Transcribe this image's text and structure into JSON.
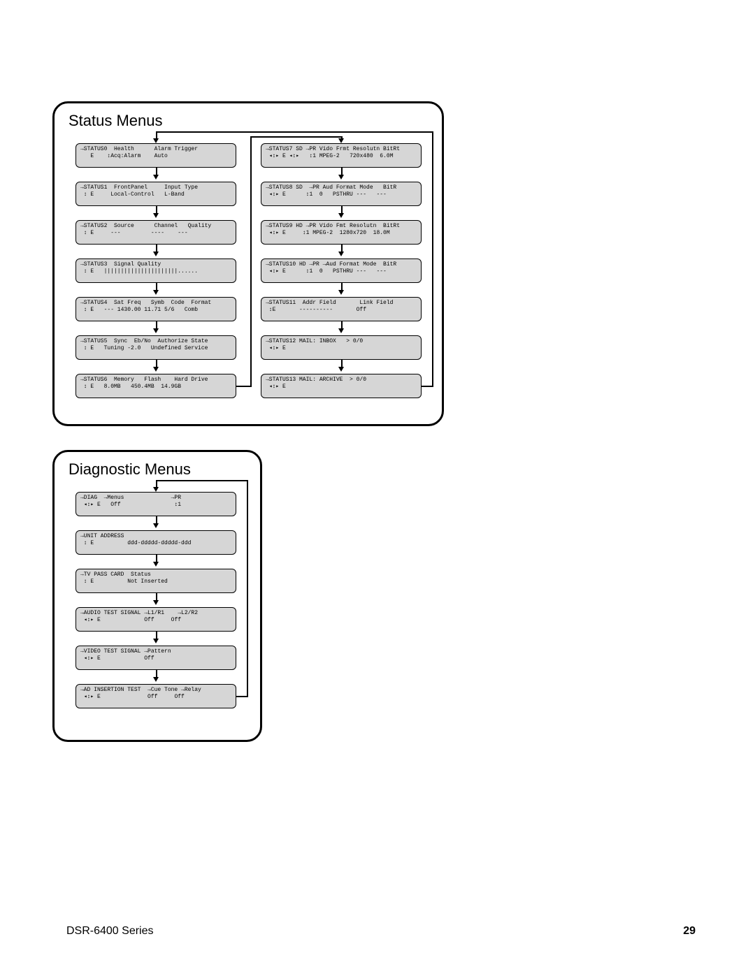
{
  "footer": {
    "model": "DSR-6400 Series",
    "page": "29"
  },
  "status": {
    "title": "Status Menus",
    "left": [
      {
        "l1": "→STATUS0  Health      Alarm Trigger",
        "l2": "   E    ↕Acq:Alarm    Auto"
      },
      {
        "l1": "→STATUS1  FrontPanel     Input Type",
        "l2": " ↕ E     Local-Control   L-Band"
      },
      {
        "l1": "→STATUS2  Source      Channel   Quality",
        "l2": " ↕ E     ---         ----    ---"
      },
      {
        "l1": "→STATUS3  Signal Quality",
        "l2": " ↕ E   ||||||||||||||||||||||......"
      },
      {
        "l1": "→STATUS4  Sat Freq   Symb  Code  Format",
        "l2": " ↕ E   --- 1430.00 11.71 5/6   Comb"
      },
      {
        "l1": "→STATUS5  Sync  Eb/No  Authorize State",
        "l2": " ↕ E   Tuning -2.0   Undefined Service"
      },
      {
        "l1": "→STATUS6  Memory   Flash    Hard Drive",
        "l2": " ↕ E   8.0MB   450.4MB  14.9GB"
      }
    ],
    "right": [
      {
        "l1": "→STATUS7 SD →PR Vido Frmt Resolutn BitRt",
        "l2": " ◂↕▸ E ◂↕▸   ↕1 MPEG-2   720x480  6.0M"
      },
      {
        "l1": "→STATUS8 SD  →PR Aud Format Mode   BitR",
        "l2": " ◂↕▸ E      ↕1  0   PSTHRU ---   ---"
      },
      {
        "l1": "→STATUS9 HD →PR Vido Fmt Resolutn  BitRt",
        "l2": " ◂↕▸ E     ↕1 MPEG-2  1280x720  18.0M"
      },
      {
        "l1": "→STATUS10 HD →PR →Aud Format Mode  BitR",
        "l2": " ◂↕▸ E      ↕1  0   PSTHRU ---   ---"
      },
      {
        "l1": "→STATUS11  Addr Field       Link Field",
        "l2": " ↕E       ----------       Off"
      },
      {
        "l1": "→STATUS12 MAIL: INBOX   > 0/0",
        "l2": " ◂↕▸ E"
      },
      {
        "l1": "→STATUS13 MAIL: ARCHIVE  > 0/0",
        "l2": " ◂↕▸ E"
      }
    ]
  },
  "diag": {
    "title": "Diagnostic Menus",
    "rows": [
      {
        "l1": "→DIAG  →Menus              →PR",
        "l2": " ◂↕▸ E   Off                ↕1"
      },
      {
        "l1": "→UNIT ADDRESS",
        "l2": " ↕ E          ddd-ddddd-ddddd-ddd"
      },
      {
        "l1": "→TV PASS CARD  Status",
        "l2": " ↕ E          Not Inserted"
      },
      {
        "l1": "→AUDIO TEST SIGNAL →L1/R1    →L2/R2",
        "l2": " ◂↕▸ E             Off     Off"
      },
      {
        "l1": "→VIDEO TEST SIGNAL →Pattern",
        "l2": " ◂↕▸ E             Off"
      },
      {
        "l1": "→AD INSERTION TEST  →Cue Tone →Relay",
        "l2": " ◂↕▸ E              Off     Off"
      }
    ]
  }
}
